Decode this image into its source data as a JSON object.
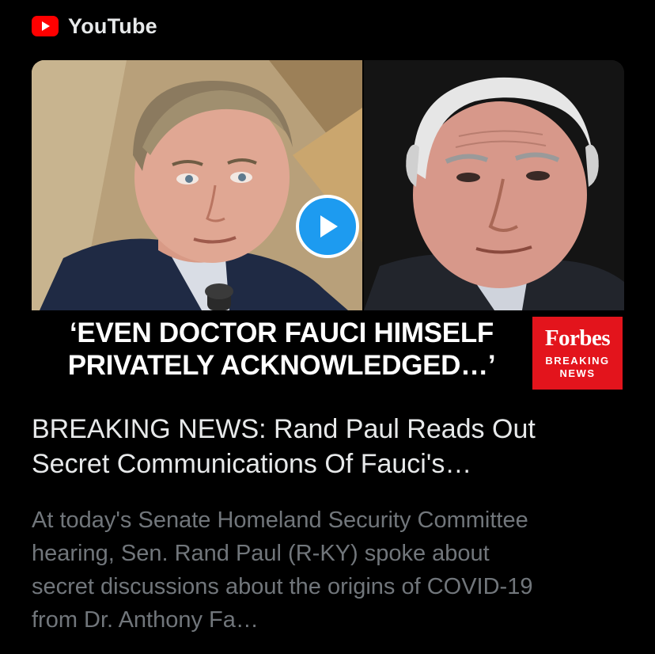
{
  "source": {
    "icon": "youtube-logo-icon",
    "name": "YouTube",
    "brand_color": "#ff0000"
  },
  "thumbnail": {
    "headline_lines": [
      "‘EVEN DOCTOR FAUCI HIMSELF",
      "PRIVATELY ACKNOWLEDGED…’"
    ],
    "badge": {
      "logo_text": "Forbes",
      "sub_lines": [
        "BREAKING",
        "NEWS"
      ],
      "color": "#e3141c"
    },
    "play_icon": "play-icon",
    "play_color": "#1d9bf0"
  },
  "card": {
    "title_lines": [
      "BREAKING NEWS: Rand Paul Reads Out",
      "Secret Communications Of Fauci's…"
    ],
    "description_lines": [
      "At today's Senate Homeland Security Committee",
      "hearing, Sen. Rand Paul (R-KY) spoke about",
      "secret discussions about the origins of COVID-19",
      "from Dr. Anthony Fa…"
    ]
  }
}
